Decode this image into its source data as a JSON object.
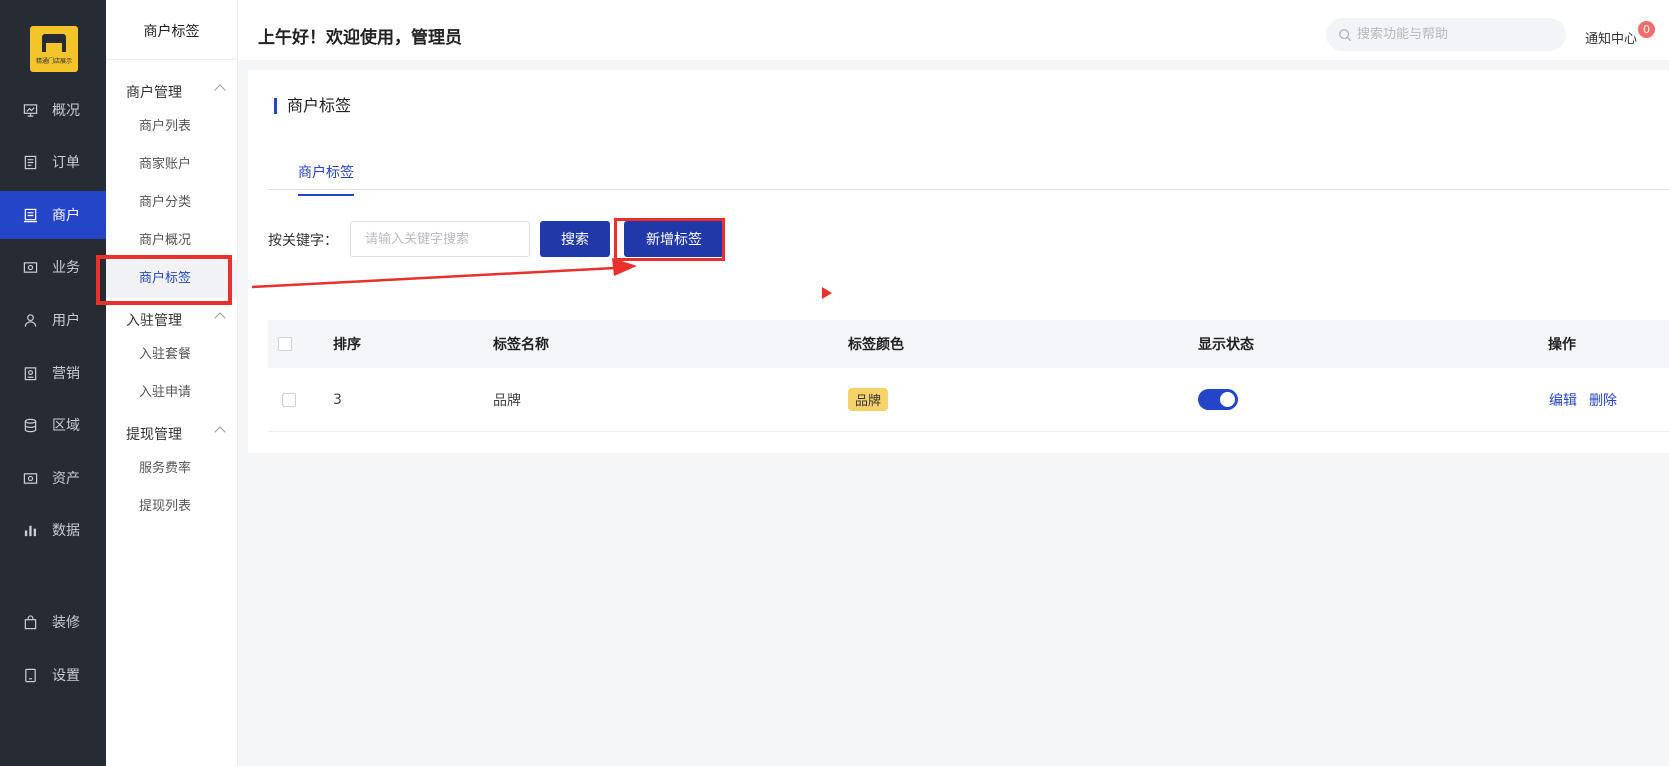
{
  "nav": {
    "logo_text": "精通门店展示",
    "items": [
      {
        "label": "概况",
        "icon": "chart-board-icon"
      },
      {
        "label": "订单",
        "icon": "document-icon"
      },
      {
        "label": "商户",
        "icon": "store-icon"
      },
      {
        "label": "业务",
        "icon": "business-icon"
      },
      {
        "label": "用户",
        "icon": "user-icon"
      },
      {
        "label": "营销",
        "icon": "marketing-icon"
      },
      {
        "label": "区域",
        "icon": "database-icon"
      },
      {
        "label": "资产",
        "icon": "assets-icon"
      },
      {
        "label": "数据",
        "icon": "bar-chart-icon"
      },
      {
        "label": "装修",
        "icon": "bag-icon"
      },
      {
        "label": "设置",
        "icon": "settings-icon"
      }
    ],
    "active": "商户"
  },
  "subnav": {
    "title": "商户标签",
    "groups": [
      {
        "label": "商户管理",
        "items": [
          "商户列表",
          "商家账户",
          "商户分类",
          "商户概况",
          "商户标签"
        ]
      },
      {
        "label": "入驻管理",
        "items": [
          "入驻套餐",
          "入驻申请"
        ]
      },
      {
        "label": "提现管理",
        "items": [
          "服务费率",
          "提现列表"
        ]
      }
    ],
    "active": "商户标签"
  },
  "header": {
    "greeting": "上午好！欢迎使用，管理员",
    "search_placeholder": "搜索功能与帮助",
    "notice_label": "通知中心",
    "notice_count": "0"
  },
  "main": {
    "title": "商户标签",
    "tab": "商户标签",
    "filter": {
      "keyword_label": "按关键字：",
      "keyword_placeholder": "请输入关键字搜索",
      "search_button": "搜索",
      "add_button": "新增标签"
    },
    "table": {
      "columns": [
        "排序",
        "标签名称",
        "标签颜色",
        "显示状态",
        "操作"
      ],
      "rows": [
        {
          "sort": "3",
          "name": "品牌",
          "color_label": "品牌",
          "color": "#f6d36a",
          "status_on": true,
          "actions": [
            "编辑",
            "删除"
          ]
        }
      ]
    }
  },
  "colors": {
    "primary": "#2545c9",
    "sidebar": "#272b33",
    "highlight": "#e8302c"
  }
}
